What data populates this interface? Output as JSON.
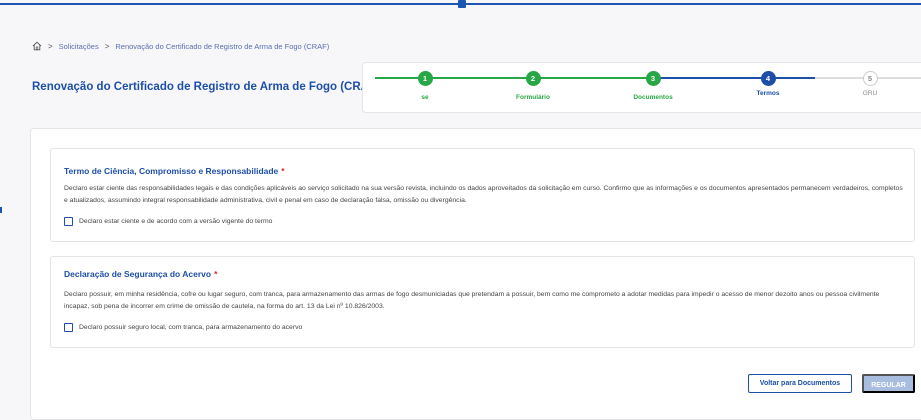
{
  "breadcrumb": {
    "home_icon": "home-icon",
    "items": [
      "Solicitações",
      "Renovação do Certificado de Registro de Arma de Fogo (CRAF)"
    ],
    "separator": ">"
  },
  "page": {
    "title": "Renovação do Certificado de Registro de Arma de Fogo (CRAF)"
  },
  "stepper": {
    "steps": [
      {
        "number": "1",
        "label": "se",
        "status": "done"
      },
      {
        "number": "2",
        "label": "Formulário",
        "status": "done"
      },
      {
        "number": "3",
        "label": "Documentos",
        "status": "done"
      },
      {
        "number": "4",
        "label": "Termos",
        "status": "current"
      },
      {
        "number": "5",
        "label": "GRU",
        "status": "pending"
      }
    ]
  },
  "terms": {
    "title": "Termo de Ciência, Compromisso e Responsabilidade",
    "required_mark": "*",
    "text": "Declaro estar ciente das responsabilidades legais e das condições aplicáveis ao serviço solicitado na sua versão revista, incluindo os dados aproveitados da solicitação em curso. Confirmo que as informações e os documentos apresentados permanecem verdadeiros, completos e atualizados, assumindo integral responsabilidade administrativa, civil e penal em caso de declaração falsa, omissão ou divergência.",
    "checkbox_label": "Declaro estar ciente e de acordo com a versão vigente do termo",
    "checked": false
  },
  "security": {
    "title": "Declaração de Segurança do Acervo",
    "required_mark": "*",
    "text": "Declaro possuir, em minha residência, cofre ou lugar seguro, com tranca, para armazenamento das armas de fogo desmuniciadas que pretendam a possuir, bem como me comprometo a adotar medidas para impedir o acesso de menor dezoito anos ou pessoa civilmente incapaz, sob pena de incorrer em crime de omissão de cautela, na forma do art. 13 da Lei nº 10.826/2003.",
    "checkbox_label": "Declaro possuir seguro local, com tranca, para armazenamento do acervo",
    "checked": false
  },
  "actions": {
    "back_label": "Voltar para Documentos",
    "submit_label": "REGULAR"
  },
  "colors": {
    "primary": "#1d4fa8",
    "success": "#27a745",
    "required": "#d9262b",
    "disabled": "#a9bde0"
  }
}
